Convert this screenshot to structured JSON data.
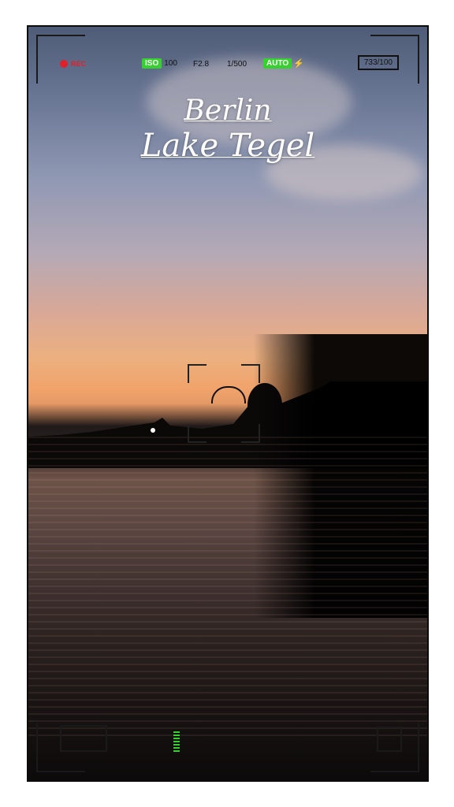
{
  "hud": {
    "rec_label": "REC",
    "iso_label": "ISO",
    "iso_value": "100",
    "aperture": "F2.8",
    "shutter": "1/500",
    "wb_label": "AUTO",
    "flash_icon": "bolt-icon",
    "counter": "733/100"
  },
  "overlay": {
    "title_line1": "Berlin",
    "title_line2": "Lake Tegel"
  },
  "colors": {
    "rec": "#e0202a",
    "pill": "#36d12e",
    "hud_text": "#111111",
    "title": "#ffffff"
  }
}
